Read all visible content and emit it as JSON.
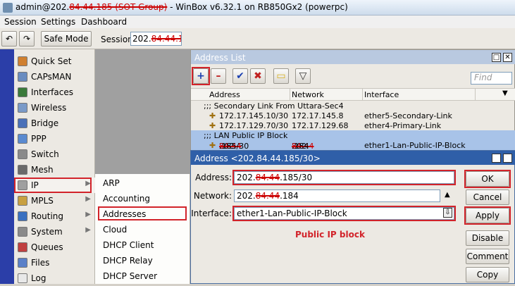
{
  "titlebar": {
    "prefix": "admin@202.",
    "redacted_part": "84.44.185 (SOT Group)",
    "suffix": " - WinBox v6.32.1 on RB850Gx2 (powerpc)"
  },
  "menu": [
    "Session",
    "Settings",
    "Dashboard"
  ],
  "toolbar": {
    "undo_glyph": "↶",
    "redo_glyph": "↷",
    "safe_mode": "Safe Mode",
    "session_label": "Session:",
    "session_prefix": "202.",
    "session_redacted": "84.44.185"
  },
  "sidebar": {
    "items": [
      {
        "label": "Quick Set",
        "icon": "quick-set-icon",
        "color": "#d08030"
      },
      {
        "label": "CAPsMAN",
        "icon": "capsman-icon",
        "color": "#6a8cc0"
      },
      {
        "label": "Interfaces",
        "icon": "interfaces-icon",
        "color": "#3a7a3a"
      },
      {
        "label": "Wireless",
        "icon": "wireless-icon",
        "color": "#7a9ac8"
      },
      {
        "label": "Bridge",
        "icon": "bridge-icon",
        "color": "#4a70b8"
      },
      {
        "label": "PPP",
        "icon": "ppp-icon",
        "color": "#5a8ad0"
      },
      {
        "label": "Switch",
        "icon": "switch-icon",
        "color": "#8a8a8a"
      },
      {
        "label": "Mesh",
        "icon": "mesh-icon",
        "color": "#6a6a6a"
      },
      {
        "label": "IP",
        "icon": "ip-icon",
        "color": "#a0a0a0"
      },
      {
        "label": "MPLS",
        "icon": "mpls-icon",
        "color": "#c8a040"
      },
      {
        "label": "Routing",
        "icon": "routing-icon",
        "color": "#3a70c0"
      },
      {
        "label": "System",
        "icon": "system-icon",
        "color": "#8a8a8a"
      },
      {
        "label": "Queues",
        "icon": "queues-icon",
        "color": "#c04040"
      },
      {
        "label": "Files",
        "icon": "files-icon",
        "color": "#5a80c8"
      },
      {
        "label": "Log",
        "icon": "log-icon",
        "color": "#e8e8e8"
      }
    ],
    "arrow_glyph": "▶"
  },
  "submenu": {
    "items": [
      "ARP",
      "Accounting",
      "Addresses",
      "Cloud",
      "DHCP Client",
      "DHCP Relay",
      "DHCP Server"
    ]
  },
  "address_list": {
    "title": "Address List",
    "btn_glyphs": {
      "add": "+",
      "remove": "–",
      "enable": "✔",
      "disable": "✖",
      "comment": "▭",
      "filter": "▽",
      "restore": "□",
      "close": "✕",
      "dropdown": "▼"
    },
    "find_placeholder": "Find",
    "columns": [
      "Address",
      "Network",
      "Interface"
    ],
    "rows": [
      {
        "type": "comment",
        "text": ";;; Secondary Link From Uttara-Sec4"
      },
      {
        "type": "entry",
        "address": "172.17.145.10/30",
        "network": "172.17.145.8",
        "interface": "ether5-Secondary-Link"
      },
      {
        "type": "entry",
        "address": "172.17.129.70/30",
        "network": "172.17.129.68",
        "interface": "ether4-Primary-Link"
      },
      {
        "type": "comment",
        "text": ";;; LAN Public IP Block"
      },
      {
        "type": "entry",
        "address_prefix": "202.",
        "address_redacted": "84.44",
        "address_suffix": ".185/30",
        "network_prefix": "202.",
        "network_redacted": "84.44",
        "network_suffix": ".184",
        "interface": "ether1-Lan-Public-IP-Block"
      }
    ]
  },
  "dialog": {
    "title": "Address <202.84.44.185/30>",
    "address_label": "Address:",
    "address_prefix": "202.",
    "address_redacted": "84.44",
    "address_suffix": ".185/30",
    "network_label": "Network:",
    "network_prefix": "202.",
    "network_redacted": "84.44",
    "network_suffix": ".184",
    "interface_label": "Interface:",
    "interface_value": "ether1-Lan-Public-IP-Block",
    "annotation": "Public IP block",
    "glyphs": {
      "up_arrow": "▲",
      "select_arrow": "⇩"
    },
    "buttons": [
      "OK",
      "Cancel",
      "Apply",
      "Disable",
      "Comment",
      "Copy"
    ]
  },
  "colors": {
    "accent_highlight": "#d2232a",
    "selected_row": "#a8c3e8",
    "dialog_title": "#2f5fa8",
    "annotation": "#d2232a"
  }
}
